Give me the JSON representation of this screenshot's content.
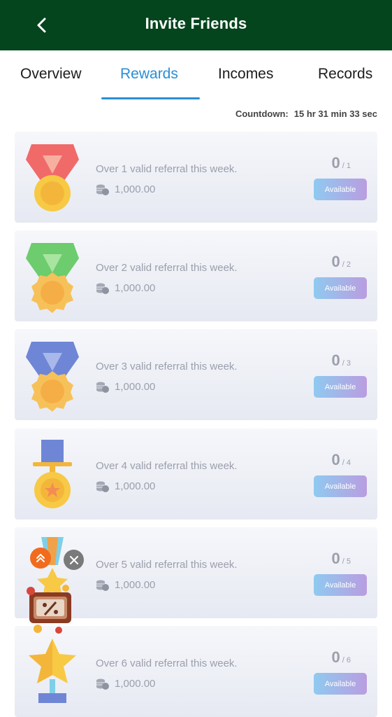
{
  "header": {
    "title": "Invite Friends",
    "back_icon": "chevron-left-icon"
  },
  "tabs": [
    {
      "label": "Overview",
      "active": false
    },
    {
      "label": "Rewards",
      "active": true
    },
    {
      "label": "Incomes",
      "active": false
    },
    {
      "label": "Records",
      "active": false
    }
  ],
  "countdown": {
    "label": "Countdown:",
    "value": "15 hr 31 min 33 sec"
  },
  "rewards": [
    {
      "description": "Over 1 valid referral this week.",
      "amount": "1,000.00",
      "current": "0",
      "target": "/ 1",
      "status": "Available",
      "medal": "red-ribbon-medal-icon"
    },
    {
      "description": "Over 2 valid referral this week.",
      "amount": "1,000.00",
      "current": "0",
      "target": "/ 2",
      "status": "Available",
      "medal": "green-ribbon-medal-icon"
    },
    {
      "description": "Over 3 valid referral this week.",
      "amount": "1,000.00",
      "current": "0",
      "target": "/ 3",
      "status": "Available",
      "medal": "blue-ribbon-medal-icon"
    },
    {
      "description": "Over 4 valid referral this week.",
      "amount": "1,000.00",
      "current": "0",
      "target": "/ 4",
      "status": "Available",
      "medal": "star-medal-icon"
    },
    {
      "description": "Over 5 valid referral this week.",
      "amount": "1,000.00",
      "current": "0",
      "target": "/ 5",
      "status": "Available",
      "medal": "star-trophy-icon"
    },
    {
      "description": "Over 6 valid referral this week.",
      "amount": "1,000.00",
      "current": "0",
      "target": "/ 6",
      "status": "Available",
      "medal": "star-trophy-icon"
    }
  ],
  "colors": {
    "header_bg": "#05451e",
    "accent": "#2a8ed5",
    "muted_text": "#9a9fab"
  },
  "floating": {
    "scroll_up_icon": "double-chevron-up-icon",
    "close_icon": "close-icon",
    "promo_icon": "discount-gift-icon"
  }
}
